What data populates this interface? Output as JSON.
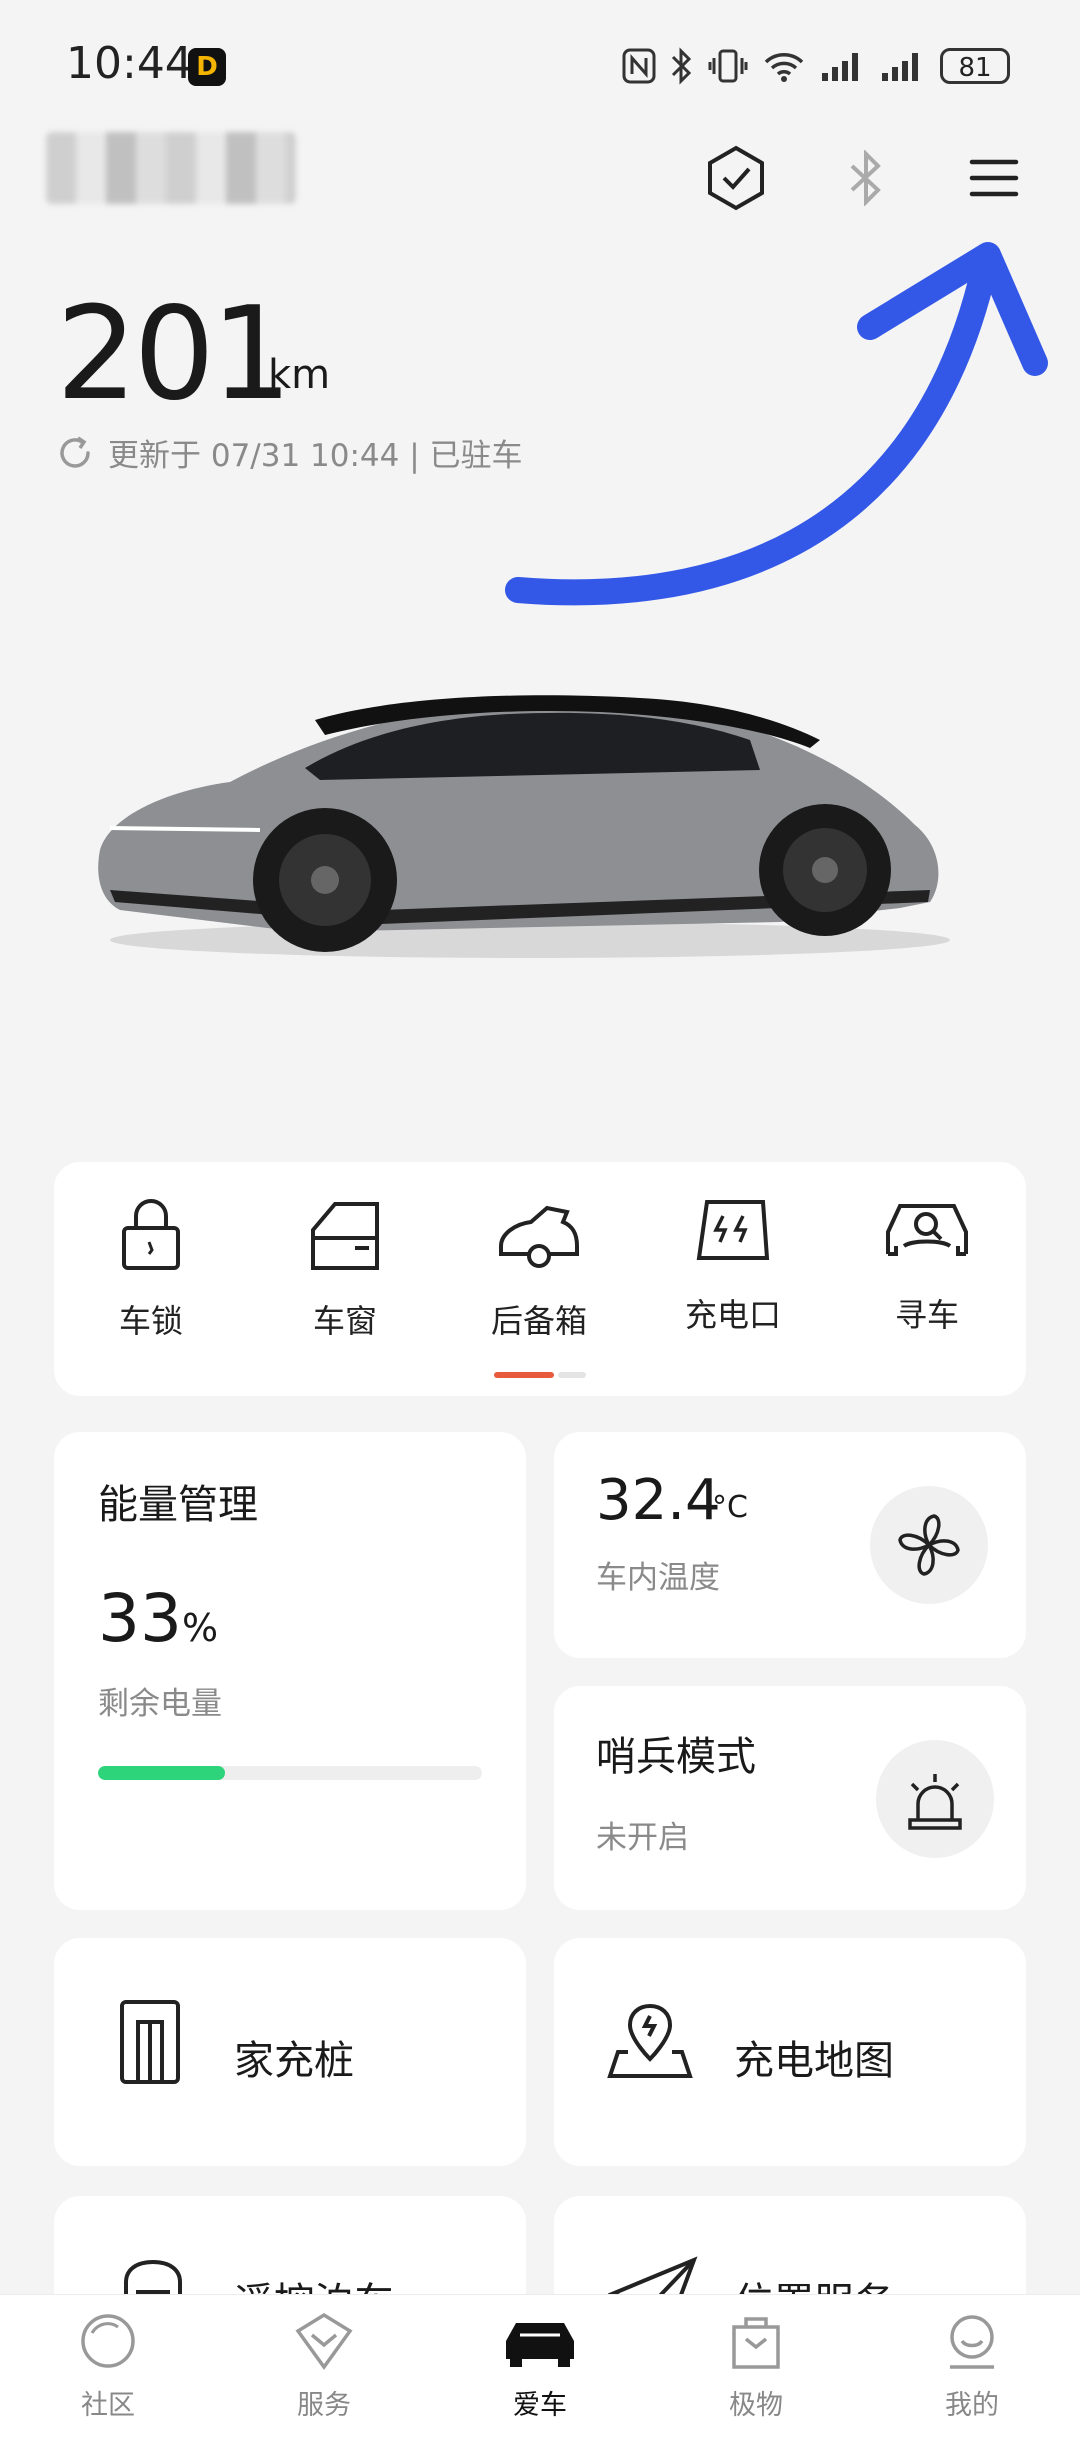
{
  "status_bar": {
    "time": "10:44",
    "badge": "D",
    "battery": "81"
  },
  "header": {
    "username": "",
    "icons": [
      "shield-check-icon",
      "bluetooth-icon",
      "menu-icon"
    ]
  },
  "vehicle": {
    "range_value": "201",
    "range_unit": "km",
    "updated_text": "更新于 07/31 10:44 | 已驻车"
  },
  "quick_controls": [
    {
      "label": "车锁",
      "icon": "lock-icon"
    },
    {
      "label": "车窗",
      "icon": "car-window-icon"
    },
    {
      "label": "后备箱",
      "icon": "trunk-icon"
    },
    {
      "label": "充电口",
      "icon": "charge-port-icon"
    },
    {
      "label": "寻车",
      "icon": "find-car-icon"
    }
  ],
  "energy": {
    "title": "能量管理",
    "value": "33",
    "unit": "%",
    "label": "剩余电量",
    "level": 0.33,
    "bar_color": "#2ed47a"
  },
  "cabin_temp": {
    "value": "32.4",
    "unit": "°C",
    "label": "车内温度",
    "icon": "fan-icon"
  },
  "sentry": {
    "title": "哨兵模式",
    "status": "未开启",
    "icon": "alarm-light-icon"
  },
  "home_charger": {
    "label": "家充桩",
    "icon": "charger-pile-icon"
  },
  "charge_map": {
    "label": "充电地图",
    "icon": "map-pin-icon"
  },
  "remote_parking": {
    "label": "遥控泊车",
    "icon": "parking-icon"
  },
  "location_service": {
    "label": "位置服务",
    "icon": "send-icon"
  },
  "bottom_nav": [
    {
      "label": "社区",
      "icon": "community-icon",
      "active": false
    },
    {
      "label": "服务",
      "icon": "service-icon",
      "active": false
    },
    {
      "label": "爱车",
      "icon": "car-icon",
      "active": true
    },
    {
      "label": "极物",
      "icon": "shop-bag-icon",
      "active": false
    },
    {
      "label": "我的",
      "icon": "profile-icon",
      "active": false
    }
  ],
  "accent_color": "#e85a3c",
  "annotation_color": "#3358e8"
}
